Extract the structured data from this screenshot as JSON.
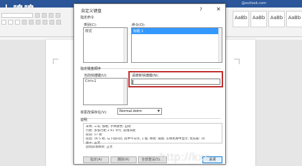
{
  "watermark": "卜嗅嗅",
  "account": "@outlook.com",
  "style_tiles": [
    "AaBb",
    "AaBb",
    "AaBb",
    "AaBb"
  ],
  "dialog": {
    "title": "自定义键盘",
    "help": "?",
    "close": "✕",
    "specify_command_label": "指定命令",
    "categories_label": "类别(C):",
    "categories": [
      "样式"
    ],
    "commands_label": "命令(O):",
    "commands": [
      "标题 1"
    ],
    "shortcut_group_label": "指定键盘顺序",
    "current_keys_label": "当前快捷键(U):",
    "current_keys": [
      "Ctrl+1"
    ],
    "new_key_label": "请按新快捷键(N):",
    "new_key_value": "",
    "save_in_label": "将更改保存在(V):",
    "save_in_value": "Normal.dotm",
    "description_label": "说明",
    "description_lines": [
      "宋体, 三号, 加粗, 字体颜色: 自动",
      "    行距: 多倍行距 2.41 字行, 段落间距",
      "    段前: 17 磅",
      "    段后: 16.5 磅, 与下段同页, 段中不分页, 1 级, 样式: 链接, 在样式库中显示, 优先级: 10",
      "    基于: 正文",
      "    后续段落样式: 正文"
    ],
    "buttons": {
      "assign": "指定(A)",
      "remove": "删除(R)",
      "reset": "全部重设(S)...",
      "close": "关闭"
    }
  },
  "url_watermark": "http://kxc"
}
